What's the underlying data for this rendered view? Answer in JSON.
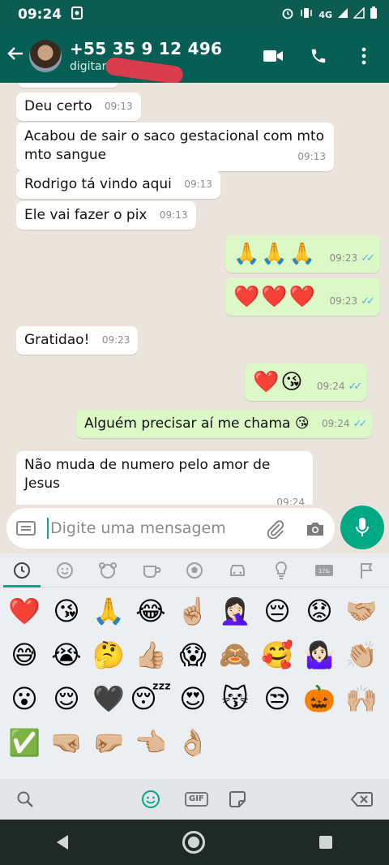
{
  "status_bar": {
    "time": "09:24",
    "network": "4G"
  },
  "header": {
    "contact_name": "+55 35 9 12 496",
    "contact_status": "digitando..."
  },
  "messages": [
    {
      "dir": "in",
      "text": "Deu certo",
      "time": "09:13"
    },
    {
      "dir": "in",
      "text": "Acabou de sair o saco gestacional com mto mto sangue",
      "time": "09:13"
    },
    {
      "dir": "in",
      "text": "Rodrigo tá vindo aqui",
      "time": "09:13"
    },
    {
      "dir": "in",
      "text": "Ele vai fazer o pix",
      "time": "09:13"
    },
    {
      "dir": "out",
      "text": "🙏🙏🙏",
      "time": "09:23"
    },
    {
      "dir": "out",
      "text": "❤️❤️❤️",
      "time": "09:23"
    },
    {
      "dir": "in",
      "text": "Gratidao!",
      "time": "09:23"
    },
    {
      "dir": "out",
      "text": "❤️😘",
      "time": "09:24"
    },
    {
      "dir": "out",
      "text": "Alguém precisar aí me chama 😘",
      "time": "09:24"
    },
    {
      "dir": "in",
      "text": "Não muda de numero pelo amor de Jesus",
      "time": "09:24"
    }
  ],
  "input": {
    "placeholder": "Digite uma mensagem"
  },
  "emoji_panel": {
    "recent": [
      "❤️",
      "😘",
      "🙏",
      "😂",
      "☝🏼",
      "🤦🏻‍♀️",
      "😔",
      "😟",
      "🤝🏼",
      "😅",
      "😭",
      "🤔",
      "👍🏼",
      "😱",
      "🙈",
      "🥰",
      "🤷🏻‍♀️",
      "👏🏼",
      "😮",
      "😌",
      "🖤",
      "😴",
      "😍",
      "😽",
      "😒",
      "🎃",
      "🙌🏼",
      "✅",
      "🤜🏼",
      "🤛🏼",
      "👈🏼",
      "👌🏼"
    ]
  },
  "keyboard_bar": {
    "gif_label": "GIF"
  }
}
